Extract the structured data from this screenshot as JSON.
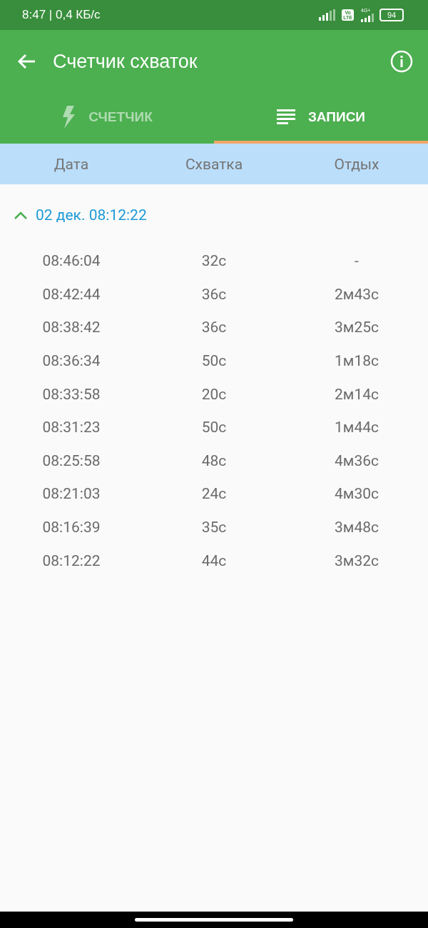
{
  "status_bar": {
    "time": "8:47 | 0,4 КБ/с",
    "volte_top": "Vo",
    "volte_bottom": "LTE",
    "network": "4G+",
    "battery": "94"
  },
  "app_bar": {
    "title": "Счетчик схваток"
  },
  "tabs": [
    {
      "label": "СЧЕТЧИК",
      "kind": "bolt",
      "selected": false
    },
    {
      "label": "ЗАПИСИ",
      "kind": "list",
      "selected": true
    }
  ],
  "table": {
    "columns": [
      "Дата",
      "Схватка",
      "Отдых"
    ],
    "groups": [
      {
        "title": "02 дек. 08:12:22",
        "expanded": true,
        "rows": [
          [
            "08:46:04",
            "32с",
            "-"
          ],
          [
            "08:42:44",
            "36с",
            "2м43с"
          ],
          [
            "08:38:42",
            "36с",
            "3м25с"
          ],
          [
            "08:36:34",
            "50с",
            "1м18с"
          ],
          [
            "08:33:58",
            "20с",
            "2м14с"
          ],
          [
            "08:31:23",
            "50с",
            "1м44с"
          ],
          [
            "08:25:58",
            "48с",
            "4м36с"
          ],
          [
            "08:21:03",
            "24с",
            "4м30с"
          ],
          [
            "08:16:39",
            "35с",
            "3м48с"
          ],
          [
            "08:12:22",
            "44с",
            "3м32с"
          ]
        ]
      }
    ]
  }
}
